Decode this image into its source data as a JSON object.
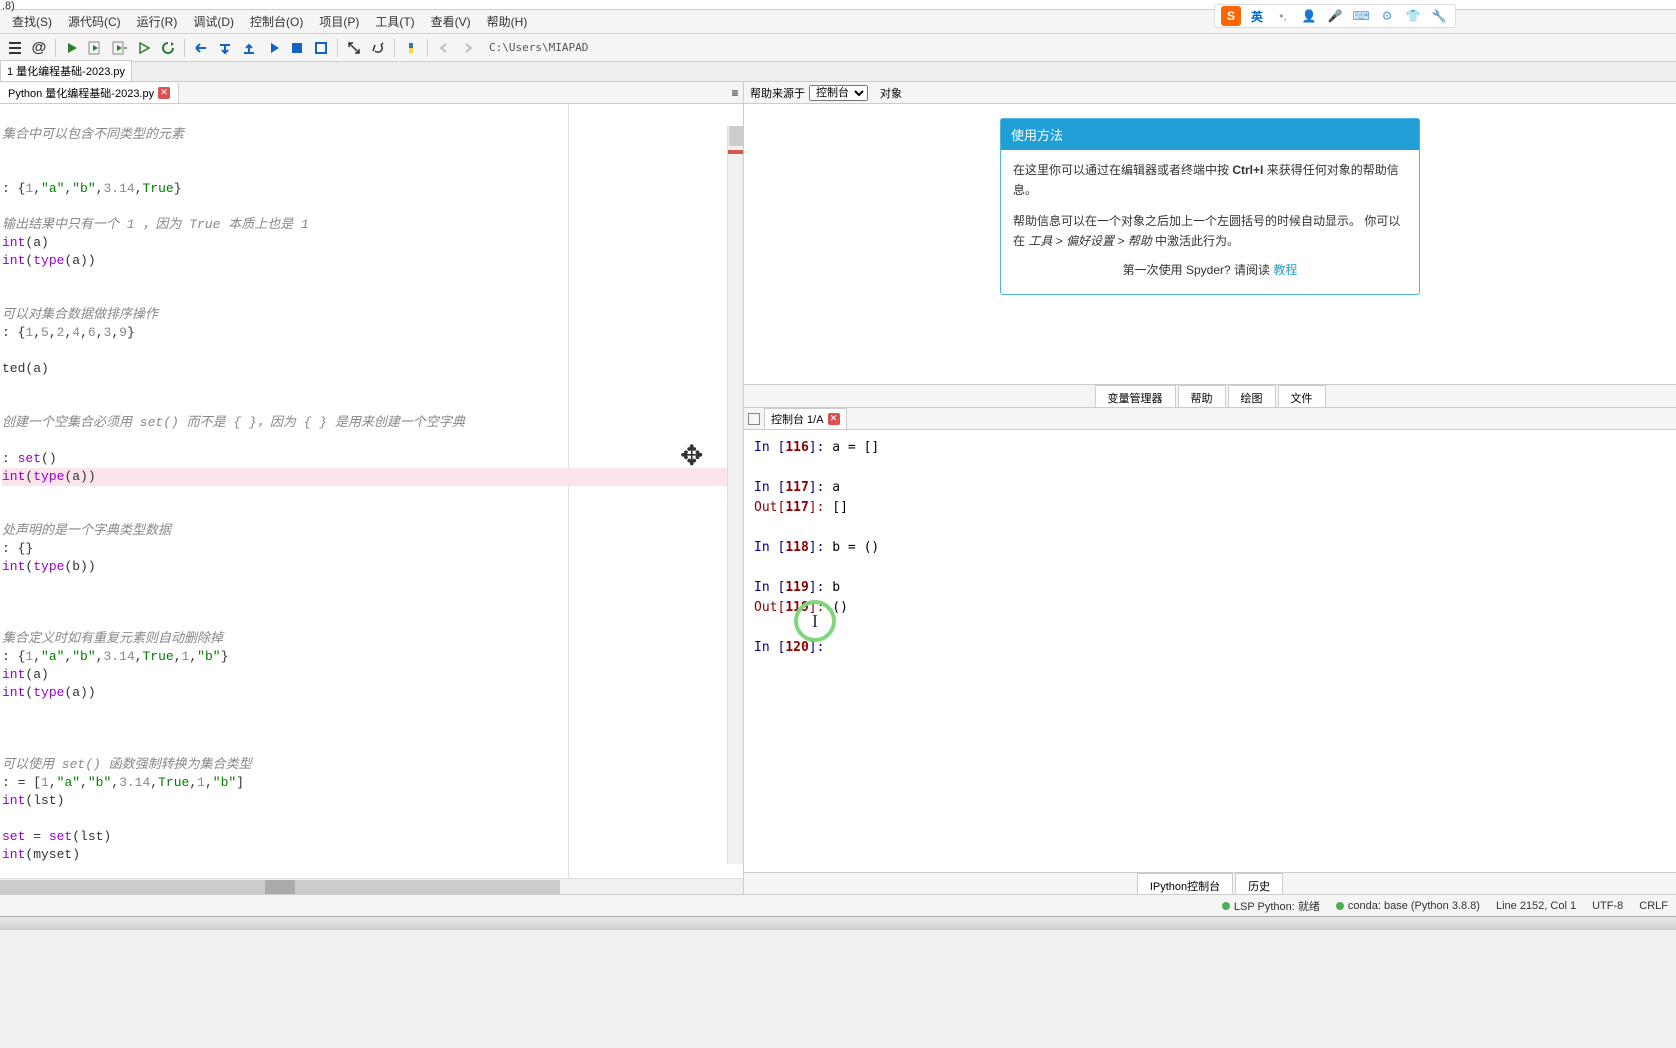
{
  "window": {
    "title_fragment": ".8)"
  },
  "menu": [
    "查找(S)",
    "源代码(C)",
    "运行(R)",
    "调试(D)",
    "控制台(O)",
    "项目(P)",
    "工具(T)",
    "查看(V)",
    "帮助(H)"
  ],
  "path": "C:\\Users\\MIAPAD",
  "file_tab": {
    "title_top": "1 量化编程基础-2023.py",
    "title": "Python 量化编程基础-2023.py"
  },
  "code": [
    "",
    "集合中可以包含不同类型的元素",
    "",
    "",
    ": {1,\"a\",\"b\",3.14,True}",
    "",
    "输出结果中只有一个 1 ，因为 True 本质上也是 1",
    "int(a)",
    "int(type(a))",
    "",
    "",
    "可以对集合数据做排序操作",
    ": {1,5,2,4,6,3,9}",
    "",
    "ted(a)",
    "",
    "",
    "创建一个空集合必须用 set() 而不是 { }，因为 { } 是用来创建一个空字典",
    "",
    ": set()",
    "int(type(a))",
    "",
    "",
    "处声明的是一个字典类型数据",
    ": {}",
    "int(type(b))",
    "",
    "",
    "",
    "集合定义时如有重复元素则自动删除掉",
    ": {1,\"a\",\"b\",3.14,True,1,\"b\"}",
    "int(a)",
    "int(type(a))",
    "",
    "",
    "",
    "可以使用 set() 函数强制转换为集合类型",
    ": = [1,\"a\",\"b\",3.14,True,1,\"b\"]",
    "int(lst)",
    "",
    "set = set(lst)",
    "int(myset)",
    ""
  ],
  "help": {
    "source_label": "帮助来源于",
    "source_selected": "控制台",
    "object_label": "对象",
    "card_title": "使用方法",
    "p1_a": "在这里你可以通过在编辑器或者终端中按 ",
    "p1_b": "Ctrl+I",
    "p1_c": " 来获得任何对象的帮助信息。",
    "p2_a": "帮助信息可以在一个对象之后加上一个左圆括号的时候自动显示。 你可以在 ",
    "p2_b": "工具 > 偏好设置 > 帮助",
    "p2_c": " 中激活此行为。",
    "footer_a": "第一次使用 Spyder? 请阅读 ",
    "footer_link": "教程"
  },
  "right_tabs": [
    "变量管理器",
    "帮助",
    "绘图",
    "文件"
  ],
  "console": {
    "tab": "控制台 1/A",
    "lines": [
      {
        "type": "in",
        "n": "116",
        "code": "a = []"
      },
      {
        "type": "blank"
      },
      {
        "type": "in",
        "n": "117",
        "code": "a"
      },
      {
        "type": "out",
        "n": "117",
        "code": "[]"
      },
      {
        "type": "blank"
      },
      {
        "type": "in",
        "n": "118",
        "code": "b = ()"
      },
      {
        "type": "blank"
      },
      {
        "type": "in",
        "n": "119",
        "code": "b"
      },
      {
        "type": "out",
        "n": "119",
        "code": "()"
      },
      {
        "type": "blank"
      },
      {
        "type": "in",
        "n": "120",
        "code": ""
      }
    ],
    "bottom_tabs": [
      "IPython控制台",
      "历史"
    ]
  },
  "status": {
    "lsp": "LSP Python: 就绪",
    "conda": "conda: base (Python 3.8.8)",
    "pos": "Line 2152, Col 1",
    "encoding": "UTF-8",
    "eol": "CRLF"
  },
  "ime": {
    "brand": "S",
    "lang": "英"
  }
}
